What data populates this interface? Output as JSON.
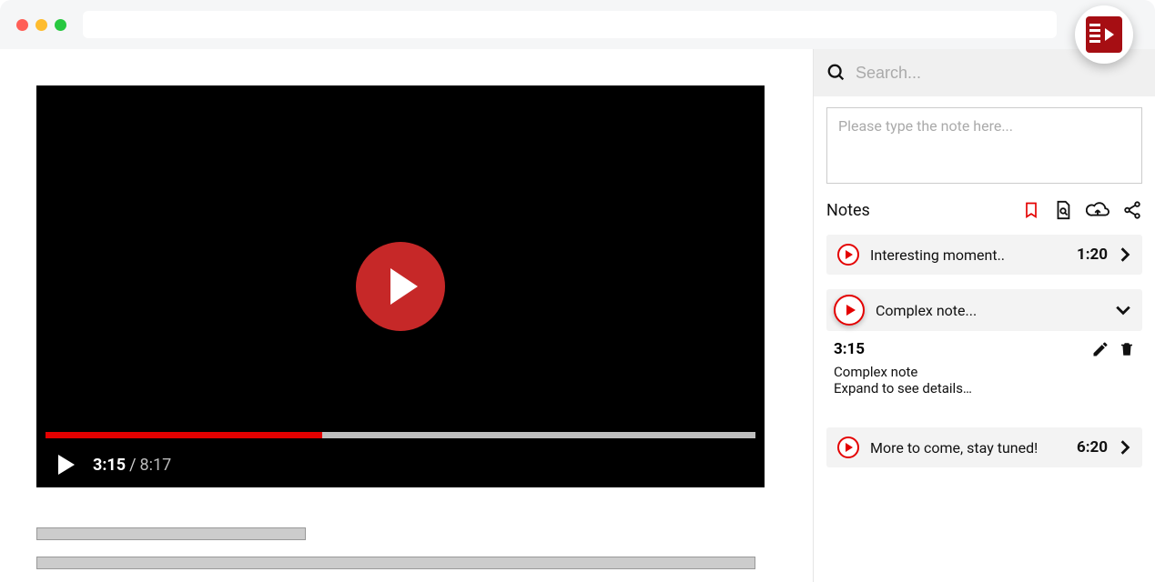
{
  "video": {
    "current_time": "3:15",
    "duration": "8:17",
    "progress_percent": 39
  },
  "search": {
    "placeholder": "Search..."
  },
  "note_input": {
    "placeholder": "Please type the note here..."
  },
  "notes_header": {
    "title": "Notes"
  },
  "notes": [
    {
      "text": "Interesting moment..",
      "time": "1:20",
      "expanded": false
    },
    {
      "text": "Complex note...",
      "time": "3:15",
      "expanded": true,
      "detail_title": "Complex note",
      "detail_sub": "Expand to see details…"
    },
    {
      "text": "More to come, stay tuned!",
      "time": "6:20",
      "expanded": false
    }
  ],
  "icons": {
    "bookmark": "bookmark-icon",
    "page_search": "page-search-icon",
    "cloud": "cloud-upload-icon",
    "share": "share-icon",
    "edit": "edit-icon",
    "trash": "trash-icon",
    "chevron_right": "chevron-right-icon",
    "chevron_down": "chevron-down-icon"
  }
}
